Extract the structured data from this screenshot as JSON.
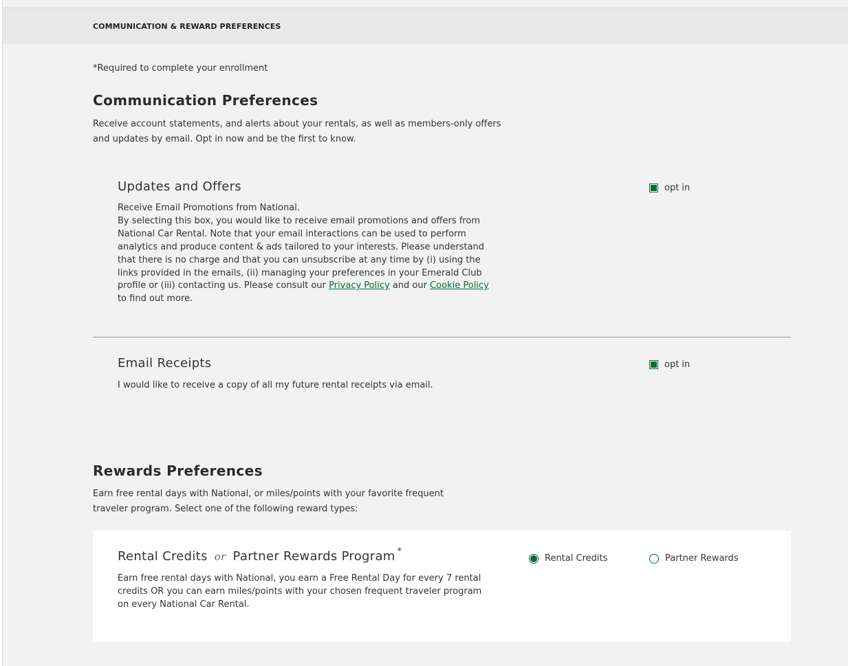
{
  "section_title": "COMMUNICATION & REWARD PREFERENCES",
  "required_note": "*Required to complete your enrollment",
  "communication": {
    "heading": "Communication Preferences",
    "intro": "Receive account statements, and alerts about your rentals, as well as members-only offers and updates by email. Opt in now and be the first to know.",
    "updates": {
      "title": "Updates and Offers",
      "line1": "Receive Email Promotions from National.",
      "text_before_privacy": "By selecting this box, you would like to receive email promotions and offers from National Car Rental. Note that your email interactions can be used to perform analytics and produce content & ads tailored to your interests. Please understand that there is no charge and that you can unsubscribe at any time by (i) using the links provided in the emails, (ii) managing your preferences in your Emerald Club profile or (iii) contacting us. Please consult our ",
      "privacy_link": "Privacy Policy",
      "text_between": " and our ",
      "cookie_link": "Cookie Policy",
      "text_after": " to find out more.",
      "checkbox_label": "opt in",
      "checked": true
    },
    "receipts": {
      "title": "Email Receipts",
      "text": "I would like to receive a copy of all my future rental receipts via email.",
      "checkbox_label": "opt in",
      "checked": true
    }
  },
  "rewards": {
    "heading": "Rewards Preferences",
    "intro": "Earn free rental days with National, or miles/points with your favorite frequent traveler program. Select one of the following reward types:",
    "card": {
      "title_a": "Rental Credits",
      "or": "or",
      "title_b": "Partner Rewards Program",
      "required_mark": "*",
      "text": "Earn free rental days with National, you earn a Free Rental Day for every 7 rental credits OR you can earn miles/points with your chosen frequent traveler program on every National Car Rental.",
      "options": [
        {
          "label": "Rental Credits",
          "selected": true
        },
        {
          "label": "Partner Rewards",
          "selected": false
        }
      ]
    }
  },
  "colors": {
    "accent": "#0b6b3a",
    "panel_bg": "#f2f2f2",
    "header_bg": "#e9e9e9"
  }
}
